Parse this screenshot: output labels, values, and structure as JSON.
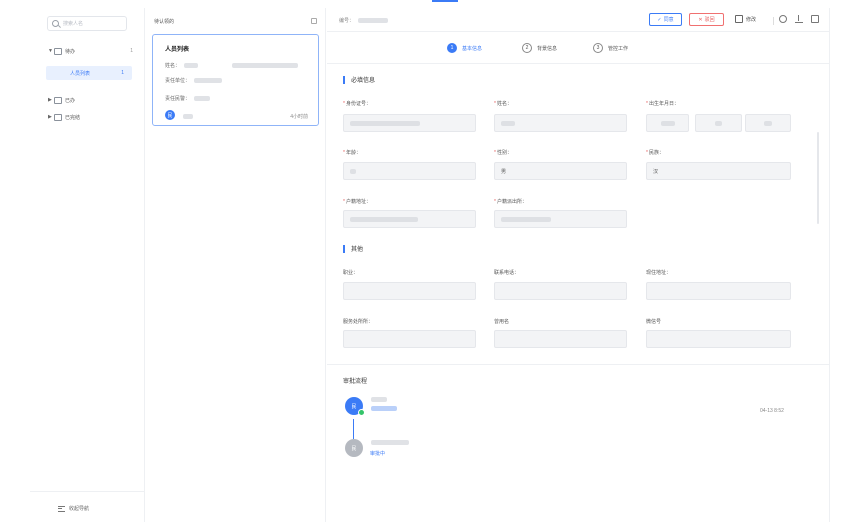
{
  "sidebar": {
    "search_placeholder": "搜索人名",
    "items": [
      {
        "label": "待办",
        "count": "1"
      },
      {
        "label": "人员列表",
        "count": "1"
      },
      {
        "label": "已办"
      },
      {
        "label": "已完结"
      }
    ],
    "collapse_label": "收起导航"
  },
  "list": {
    "header": "待认领的",
    "card": {
      "title": "人员列表",
      "name_label": "姓名：",
      "unit_label": "责任单位：",
      "responsible_label": "责任民警：",
      "avatar_text": "民",
      "time": "4小时前"
    }
  },
  "main": {
    "header_label": "编号：",
    "agree_label": "同意",
    "reject_label": "驳回",
    "edit_label": "修改",
    "steps": [
      {
        "num": "1",
        "label": "基本信息"
      },
      {
        "num": "2",
        "label": "背景信息"
      },
      {
        "num": "3",
        "label": "管控工作"
      }
    ],
    "section_required": "必填信息",
    "section_other": "其他",
    "fields": {
      "id_card": {
        "label": "身份证号："
      },
      "name": {
        "label": "姓名："
      },
      "birth": {
        "label": "出生年月日："
      },
      "age": {
        "label": "年龄："
      },
      "gender": {
        "label": "性别：",
        "value": "男"
      },
      "ethnicity": {
        "label": "民族：",
        "value": "汉"
      },
      "household_address": {
        "label": "户籍地址："
      },
      "household_police": {
        "label": "户籍派出所："
      },
      "occupation": {
        "label": "职业："
      },
      "phone": {
        "label": "联系电话："
      },
      "current_address": {
        "label": "现住地址："
      },
      "service_location": {
        "label": "服务处所所："
      },
      "nickname": {
        "label": "曾用名"
      },
      "wechat": {
        "label": "微信号"
      }
    },
    "approval": {
      "title": "审批流程",
      "node1_text": "民",
      "node2_text": "民",
      "node2_status": "审批中",
      "node1_time": "04-13 8:52"
    }
  }
}
